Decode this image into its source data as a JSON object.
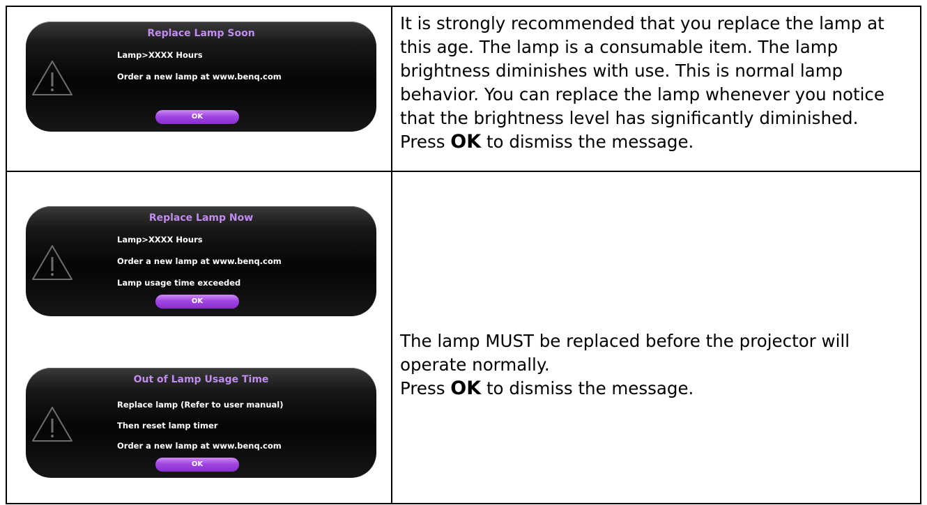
{
  "row1": {
    "dialog": {
      "title": "Replace Lamp Soon",
      "lines": [
        "Lamp>XXXX Hours",
        "Order a new lamp at www.benq.com"
      ],
      "ok_label": "OK"
    },
    "description": {
      "text": "It is strongly recommended that you replace the lamp at this age. The lamp is a consumable item. The lamp brightness diminishes with use. This is normal lamp behavior. You can replace the lamp whenever you notice that the brightness level has significantly diminished.",
      "press_prefix": "Press ",
      "press_key": "OK",
      "press_suffix": " to dismiss the message."
    }
  },
  "row2": {
    "dialog_now": {
      "title": "Replace Lamp Now",
      "lines": [
        "Lamp>XXXX Hours",
        "Order a new lamp at www.benq.com",
        "Lamp usage time exceeded"
      ],
      "ok_label": "OK"
    },
    "dialog_out": {
      "title": "Out of Lamp Usage Time",
      "lines": [
        "Replace lamp (Refer to user manual)",
        "Then reset lamp timer",
        "Order a new lamp at www.benq.com"
      ],
      "ok_label": "OK"
    },
    "description": {
      "text": "The lamp MUST be replaced before the projector will operate normally.",
      "press_prefix": "Press ",
      "press_key": "OK",
      "press_suffix": " to dismiss the message."
    }
  },
  "colors": {
    "dialog_title": "#c08cf0",
    "ok_button": "#a046e0",
    "dialog_background": "#0a0a0a"
  },
  "icons": [
    "warning-triangle-icon"
  ]
}
